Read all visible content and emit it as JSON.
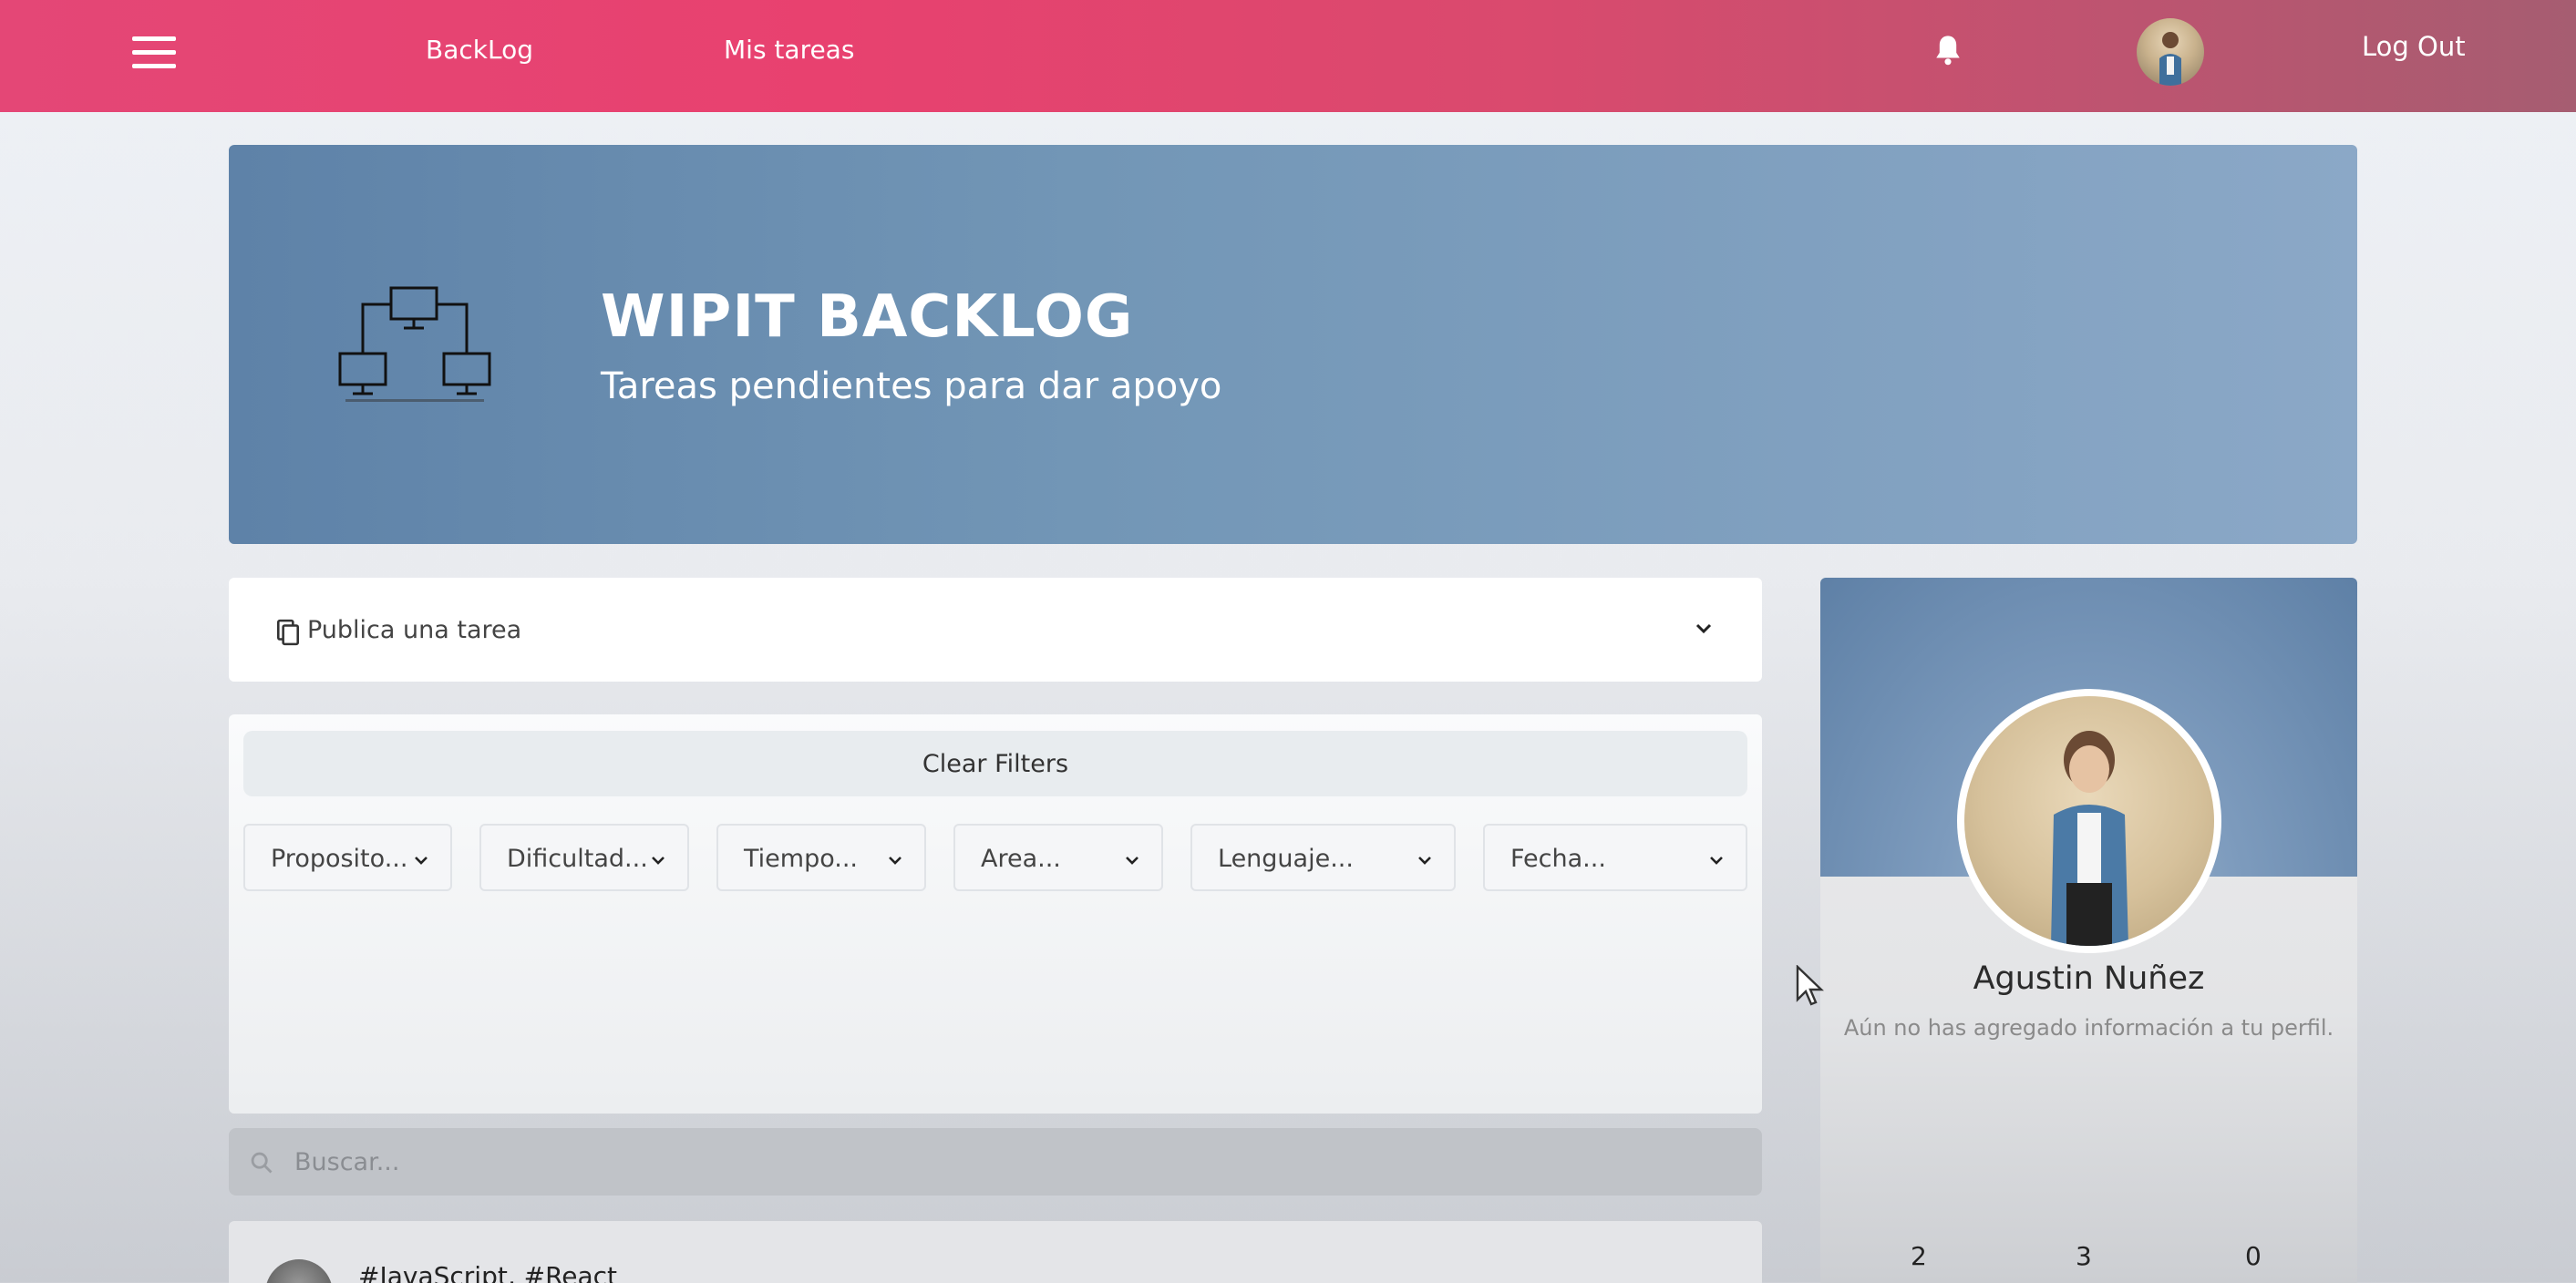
{
  "nav": {
    "links": [
      "BackLog",
      "Mis tareas"
    ],
    "logout_label": "Log Out"
  },
  "hero": {
    "title": "WIPIT BACKLOG",
    "subtitle": "Tareas pendientes para dar apoyo"
  },
  "publish": {
    "label": "Publica una tarea"
  },
  "filters": {
    "clear_label": "Clear Filters",
    "selects": [
      "Proposito...",
      "Dificultad...",
      "Tiempo...",
      "Area...",
      "Lenguaje...",
      "Fecha..."
    ]
  },
  "search": {
    "placeholder": "Buscar..."
  },
  "task": {
    "tags": "#JavaScript, #React"
  },
  "profile": {
    "name": "Agustin Nuñez",
    "bio": "Aún no has agregado información a tu perfil.",
    "stats": [
      "2",
      "3",
      "0"
    ]
  },
  "colors": {
    "nav_gradient_start": "#e44776",
    "nav_gradient_end": "#a65d71",
    "hero_blue": "#5e82a8"
  }
}
